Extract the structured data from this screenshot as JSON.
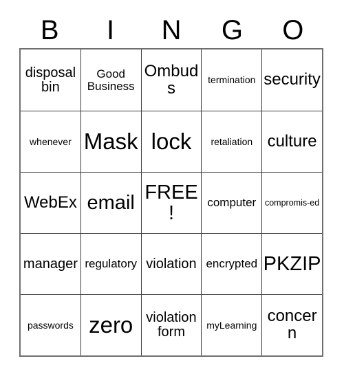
{
  "card": {
    "type": "bingo-card",
    "headers": [
      "B",
      "I",
      "N",
      "G",
      "O"
    ],
    "rows": [
      [
        {
          "text": "disposal bin",
          "size": "md"
        },
        {
          "text": "Good Business",
          "size": "sm"
        },
        {
          "text": "Ombuds",
          "size": "lg"
        },
        {
          "text": "termination",
          "size": "xs"
        },
        {
          "text": "security",
          "size": "lg"
        }
      ],
      [
        {
          "text": "whenever",
          "size": "xs"
        },
        {
          "text": "Mask",
          "size": "xxl"
        },
        {
          "text": "lock",
          "size": "xxl"
        },
        {
          "text": "retaliation",
          "size": "xs"
        },
        {
          "text": "culture",
          "size": "lg"
        }
      ],
      [
        {
          "text": "WebEx",
          "size": "lg"
        },
        {
          "text": "email",
          "size": "xl"
        },
        {
          "text": "FREE!",
          "size": "xl"
        },
        {
          "text": "computer",
          "size": "sm"
        },
        {
          "text": "compromis-ed",
          "size": "xxs"
        }
      ],
      [
        {
          "text": "manager",
          "size": "md"
        },
        {
          "text": "regulatory",
          "size": "sm"
        },
        {
          "text": "violation",
          "size": "md"
        },
        {
          "text": "encrypted",
          "size": "sm"
        },
        {
          "text": "PKZIP",
          "size": "xl"
        }
      ],
      [
        {
          "text": "passwords",
          "size": "xs"
        },
        {
          "text": "zero",
          "size": "xxl"
        },
        {
          "text": "violation form",
          "size": "md"
        },
        {
          "text": "myLearning",
          "size": "xs"
        },
        {
          "text": "concern",
          "size": "lg"
        }
      ]
    ],
    "free_space": {
      "row": 2,
      "column": 2,
      "label": "FREE!"
    },
    "colors": {
      "background": "#ffffff",
      "text": "#000000",
      "grid_line": "#3a3a3a",
      "outer_border": "#6f6f6f"
    }
  }
}
